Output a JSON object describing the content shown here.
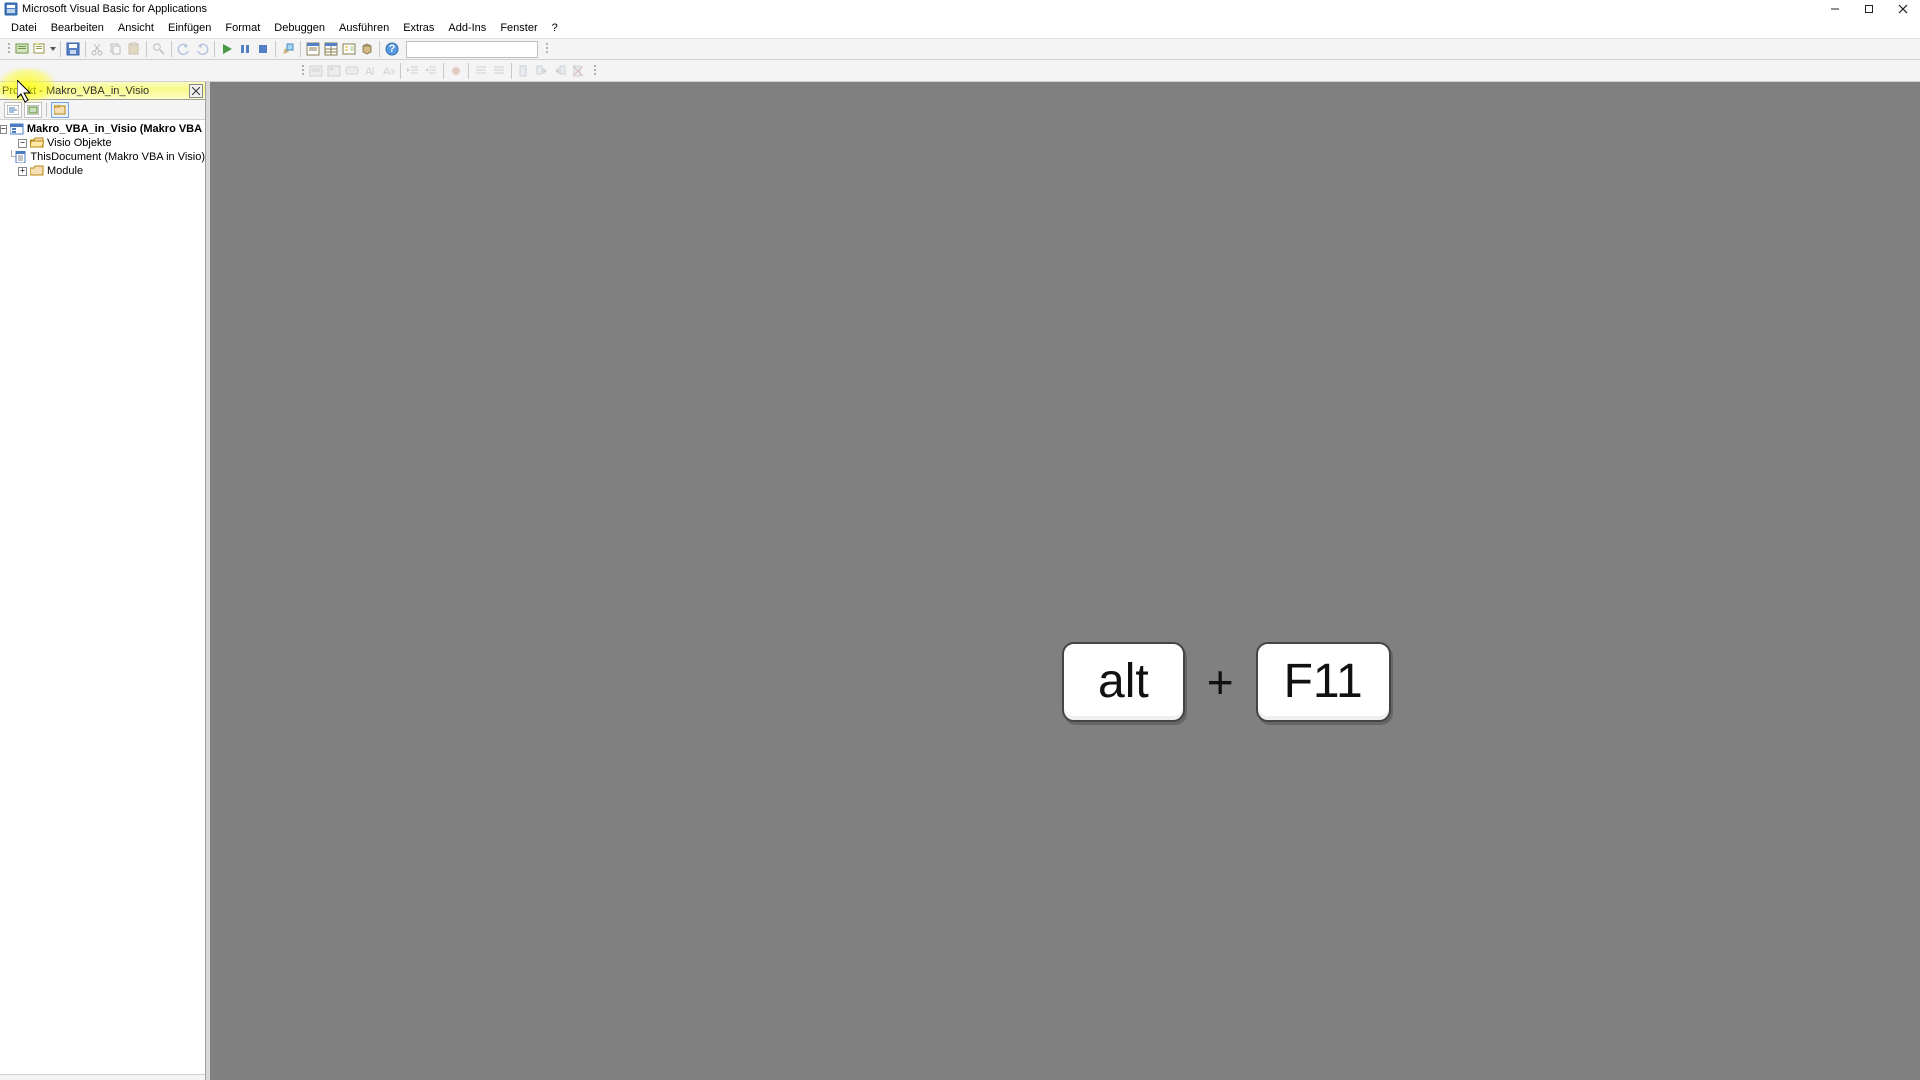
{
  "title": "Microsoft Visual Basic for Applications",
  "menu": {
    "file": "Datei",
    "edit": "Bearbeiten",
    "view": "Ansicht",
    "insert": "Einfügen",
    "format": "Format",
    "debug": "Debuggen",
    "run": "Ausführen",
    "tools": "Extras",
    "addins": "Add-Ins",
    "window": "Fenster",
    "help": "?"
  },
  "project_pane": {
    "header": "Projekt - Makro_VBA_in_Visio",
    "nodes": {
      "root": "Makro_VBA_in_Visio (Makro VBA in Visio)",
      "objects": "Visio Objekte",
      "thisdoc": "ThisDocument (Makro VBA in Visio)",
      "modules": "Module"
    }
  },
  "overlay": {
    "key1": "alt",
    "plus": "+",
    "key2": "F11"
  }
}
